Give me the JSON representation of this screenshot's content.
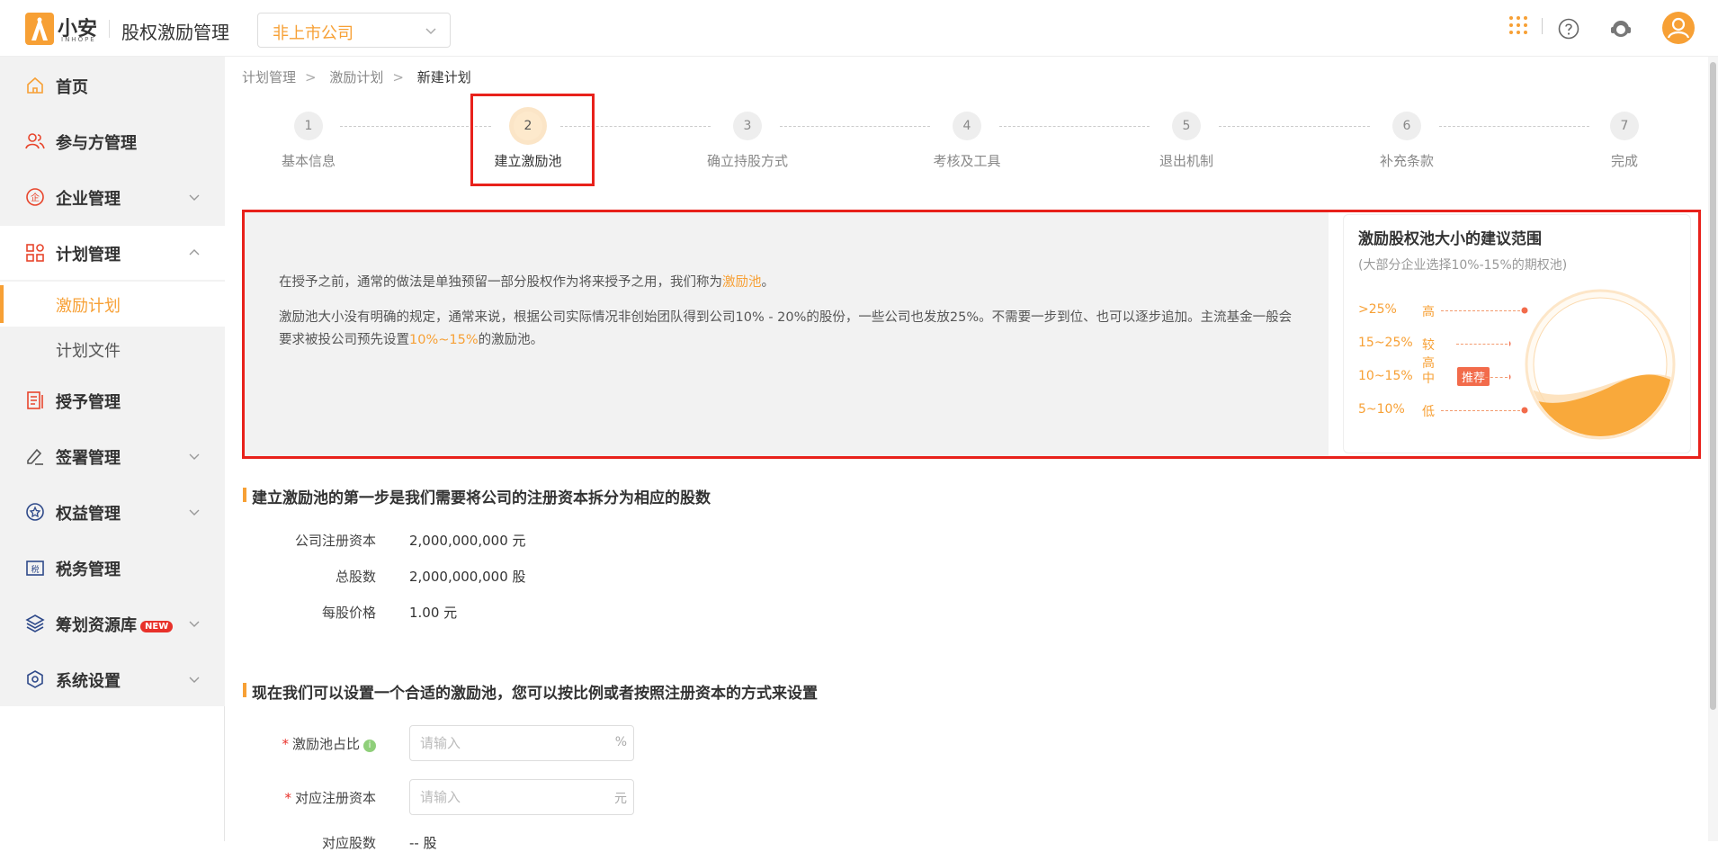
{
  "header": {
    "logo_text": "小安",
    "logo_sub": "INHOPE",
    "app_title": "股权激励管理",
    "company_select": "非上市公司",
    "icons": [
      "apps-grid-icon",
      "help-icon",
      "customer-service-icon",
      "user-avatar-icon"
    ]
  },
  "sidebar": {
    "items": [
      {
        "label": "首页",
        "icon": "home-icon"
      },
      {
        "label": "参与方管理",
        "icon": "users-icon"
      },
      {
        "label": "企业管理",
        "icon": "company-icon"
      },
      {
        "label": "计划管理",
        "icon": "plan-icon"
      },
      {
        "label": "授予管理",
        "icon": "grant-icon"
      },
      {
        "label": "签署管理",
        "icon": "sign-icon"
      },
      {
        "label": "权益管理",
        "icon": "equity-icon"
      },
      {
        "label": "税务管理",
        "icon": "tax-icon"
      },
      {
        "label": "筹划资源库",
        "icon": "layers-icon",
        "badge": "NEW"
      },
      {
        "label": "系统设置",
        "icon": "settings-icon"
      }
    ],
    "sub_items": [
      {
        "label": "激励计划"
      },
      {
        "label": "计划文件"
      }
    ]
  },
  "breadcrumb": [
    "计划管理",
    "激励计划",
    "新建计划"
  ],
  "steps": [
    {
      "num": "1",
      "label": "基本信息"
    },
    {
      "num": "2",
      "label": "建立激励池"
    },
    {
      "num": "3",
      "label": "确立持股方式"
    },
    {
      "num": "4",
      "label": "考核及工具"
    },
    {
      "num": "5",
      "label": "退出机制"
    },
    {
      "num": "6",
      "label": "补充条款"
    },
    {
      "num": "7",
      "label": "完成"
    }
  ],
  "intro": {
    "p1_prefix": "在授予之前，通常的做法是单独预留一部分股权作为将来授予之用，我们称为",
    "p1_highlight": "激励池",
    "p1_suffix": "。",
    "p2_prefix": "激励池大小没有明确的规定，通常来说，根据公司实际情况非创始团队得到公司10% - 20%的股份，一些公司也发放25%。不需要一步到位、也可以逐步追加。主流基金一般会要求被投公司预先设置",
    "p2_highlight": "10%~15%",
    "p2_suffix": "的激励池。"
  },
  "range_card": {
    "title": "激励股权池大小的建议范围",
    "subtitle": "(大部分企业选择10%-15%的期权池)",
    "levels": [
      {
        "range": ">25%",
        "name": "高"
      },
      {
        "range": "15~25%",
        "name": "较高"
      },
      {
        "range": "10~15%",
        "name": "中",
        "badge": "推荐"
      },
      {
        "range": "5~10%",
        "name": "低"
      }
    ]
  },
  "section1": {
    "title": "建立激励池的第一步是我们需要将公司的注册资本拆分为相应的股数",
    "rows": [
      {
        "label": "公司注册资本",
        "value": "2,000,000,000 元"
      },
      {
        "label": "总股数",
        "value": "2,000,000,000 股"
      },
      {
        "label": "每股价格",
        "value": "1.00 元"
      }
    ]
  },
  "section2": {
    "title": "现在我们可以设置一个合适的激励池，您可以按比例或者按照注册资本的方式来设置",
    "pool_ratio": {
      "label": "激励池占比",
      "placeholder": "请输入",
      "suffix": "%",
      "required_mark": "*"
    },
    "reg_capital": {
      "label": "对应注册资本",
      "placeholder": "请输入",
      "suffix": "元",
      "required_mark": "*"
    },
    "shares": {
      "label": "对应股数",
      "value": "-- 股"
    }
  },
  "colors": {
    "accent": "#f7a035",
    "highlight_border": "#e8211b",
    "badge_red": "#e8312a"
  }
}
